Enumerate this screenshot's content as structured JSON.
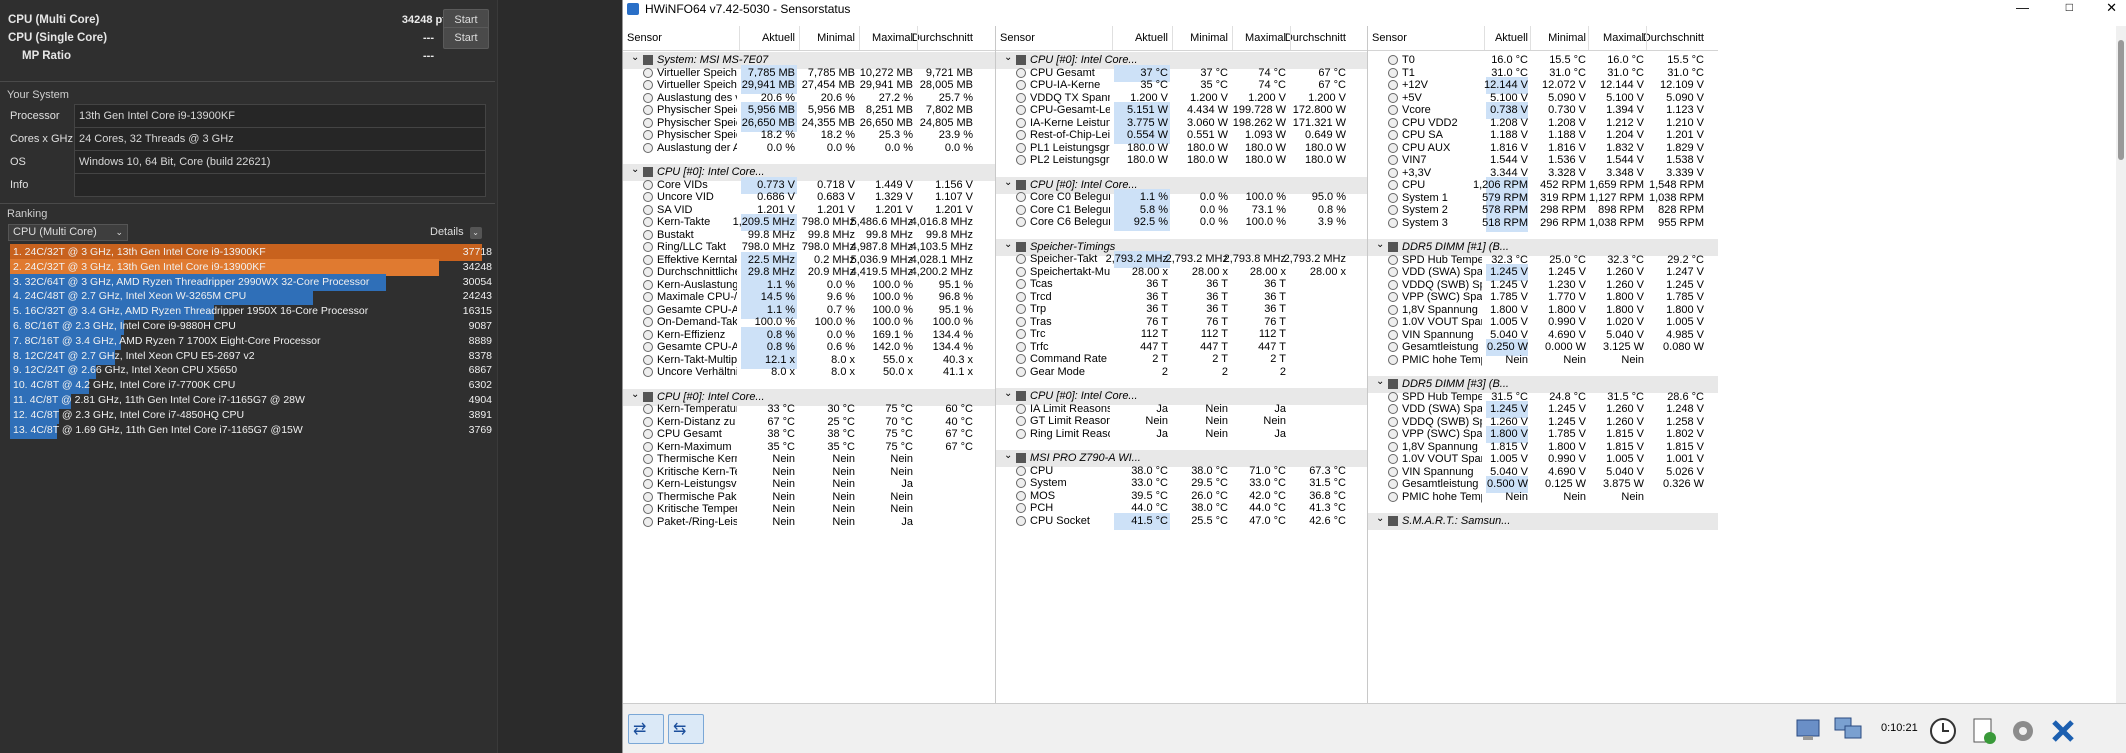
{
  "cb": {
    "mc_label": "CPU (Multi Core)",
    "mc_val": "34248 pts",
    "st_label": "CPU (Single Core)",
    "st_val": "---",
    "mp_label": "MP Ratio",
    "mp_val": "---",
    "start": "Start",
    "your_system": "Your System",
    "processor_k": "Processor",
    "processor_v": "13th Gen Intel Core i9-13900KF",
    "cores_k": "Cores x GHz",
    "cores_v": "24 Cores, 32 Threads @ 3 GHz",
    "os_k": "OS",
    "os_v": "Windows 10, 64 Bit, Core (build 22621)",
    "info_k": "Info",
    "info_v": "",
    "ranking": "Ranking",
    "rank_select": "CPU (Multi Core)",
    "details": "Details",
    "ranks": [
      {
        "t": "1. 24C/32T @ 3 GHz, 13th Gen Intel Core i9-13900KF",
        "s": "37718",
        "c": "#c8621e",
        "f": 1.0
      },
      {
        "t": "2. 24C/32T @ 3 GHz, 13th Gen Intel Core i9-13900KF",
        "s": "34248",
        "c": "#e07a30",
        "f": 0.908
      },
      {
        "t": "3. 32C/64T @ 3 GHz, AMD Ryzen Threadripper 2990WX 32-Core Processor",
        "s": "30054",
        "c": "#2f6fb8",
        "f": 0.797
      },
      {
        "t": "4. 24C/48T @ 2.7 GHz, Intel Xeon W-3265M CPU",
        "s": "24243",
        "c": "#2f6fb8",
        "f": 0.643
      },
      {
        "t": "5. 16C/32T @ 3.4 GHz, AMD Ryzen Threadripper 1950X 16-Core Processor",
        "s": "16315",
        "c": "#2f6fb8",
        "f": 0.433
      },
      {
        "t": "6. 8C/16T @ 2.3 GHz, Intel Core i9-9880H CPU",
        "s": "9087",
        "c": "#2f6fb8",
        "f": 0.241
      },
      {
        "t": "7. 8C/16T @ 3.4 GHz, AMD Ryzen 7 1700X Eight-Core Processor",
        "s": "8889",
        "c": "#2f6fb8",
        "f": 0.236
      },
      {
        "t": "8. 12C/24T @ 2.7 GHz, Intel Xeon CPU E5-2697 v2",
        "s": "8378",
        "c": "#2f6fb8",
        "f": 0.222
      },
      {
        "t": "9. 12C/24T @ 2.66 GHz, Intel Xeon CPU X5650",
        "s": "6867",
        "c": "#2f6fb8",
        "f": 0.182
      },
      {
        "t": "10. 4C/8T @ 4.2 GHz, Intel Core i7-7700K CPU",
        "s": "6302",
        "c": "#2f6fb8",
        "f": 0.167
      },
      {
        "t": "11. 4C/8T @ 2.81 GHz, 11th Gen Intel Core i7-1165G7 @ 28W",
        "s": "4904",
        "c": "#2f6fb8",
        "f": 0.13
      },
      {
        "t": "12. 4C/8T @ 2.3 GHz, Intel Core i7-4850HQ CPU",
        "s": "3891",
        "c": "#2f6fb8",
        "f": 0.103
      },
      {
        "t": "13. 4C/8T @ 1.69 GHz, 11th Gen Intel Core i7-1165G7 @15W",
        "s": "3769",
        "c": "#2f6fb8",
        "f": 0.1
      }
    ]
  },
  "hw": {
    "title": "HWiNFO64 v7.42-5030 - Sensorstatus",
    "clock": "0:10:21",
    "cols": [
      "Sensor",
      "Aktuell",
      "Minimal",
      "Maximal",
      "Durchschnitt"
    ],
    "p1": [
      [
        "g",
        "System: MSI MS-7E07"
      ],
      [
        "r",
        "Virtueller Speicher zu...",
        "7,785 MB",
        "7,785 MB",
        "10,272 MB",
        "9,721 MB",
        1
      ],
      [
        "r",
        "Virtueller Speicher ve...",
        "29,941 MB",
        "27,454 MB",
        "29,941 MB",
        "28,005 MB",
        1
      ],
      [
        "r",
        "Auslastung des virtu...",
        "20.6 %",
        "20.6 %",
        "27.2 %",
        "25.7 %",
        0
      ],
      [
        "r",
        "Physischer Speicher ...",
        "5,956 MB",
        "5,956 MB",
        "8,251 MB",
        "7,802 MB",
        1
      ],
      [
        "r",
        "Physischer Speicher ...",
        "26,650 MB",
        "24,355 MB",
        "26,650 MB",
        "24,805 MB",
        1
      ],
      [
        "r",
        "Physischer Speicher-...",
        "18.2 %",
        "18.2 %",
        "25.3 %",
        "23.9 %",
        0
      ],
      [
        "r",
        "Auslastung der Ausla...",
        "0.0 %",
        "0.0 %",
        "0.0 %",
        "0.0 %",
        0
      ],
      [
        "s"
      ],
      [
        "g",
        "CPU [#0]: Intel Core..."
      ],
      [
        "r",
        "Core VIDs",
        "0.773 V",
        "0.718 V",
        "1.449 V",
        "1.156 V",
        1
      ],
      [
        "r",
        "Uncore VID",
        "0.686 V",
        "0.683 V",
        "1.329 V",
        "1.107 V",
        0
      ],
      [
        "r",
        "SA VID",
        "1.201 V",
        "1.201 V",
        "1.201 V",
        "1.201 V",
        0
      ],
      [
        "r",
        "Kern-Takte",
        "1,209.5 MHz",
        "798.0 MHz",
        "5,486.6 MHz",
        "4,016.8 MHz",
        1
      ],
      [
        "r",
        "Bustakt",
        "99.8 MHz",
        "99.8 MHz",
        "99.8 MHz",
        "99.8 MHz",
        0
      ],
      [
        "r",
        "Ring/LLC Takt",
        "798.0 MHz",
        "798.0 MHz",
        "4,987.8 MHz",
        "4,103.5 MHz",
        0
      ],
      [
        "r",
        "Effektive Kerntakte",
        "22.5 MHz",
        "0.2 MHz",
        "5,036.9 MHz",
        "4,028.1 MHz",
        1
      ],
      [
        "r",
        "Durchschnittlicher Ef...",
        "29.8 MHz",
        "20.9 MHz",
        "4,419.5 MHz",
        "4,200.2 MHz",
        1
      ],
      [
        "r",
        "Kern-Auslastung",
        "1.1 %",
        "0.0 %",
        "100.0 %",
        "95.1 %",
        1
      ],
      [
        "r",
        "Maximale CPU-/Thre...",
        "14.5 %",
        "9.6 %",
        "100.0 %",
        "96.8 %",
        1
      ],
      [
        "r",
        "Gesamte CPU-Auslas...",
        "1.1 %",
        "0.7 %",
        "100.0 %",
        "95.1 %",
        1
      ],
      [
        "r",
        "On-Demand-Takt-Mo...",
        "100.0 %",
        "100.0 %",
        "100.0 %",
        "100.0 %",
        0
      ],
      [
        "r",
        "Kern-Effizienz",
        "0.8 %",
        "0.0 %",
        "169.1 %",
        "134.4 %",
        1
      ],
      [
        "r",
        "Gesamte CPU-Auslas...",
        "0.8 %",
        "0.6 %",
        "142.0 %",
        "134.4 %",
        1
      ],
      [
        "r",
        "Kern-Takt-Multipli...",
        "12.1 x",
        "8.0 x",
        "55.0 x",
        "40.3 x",
        1
      ],
      [
        "r",
        "Uncore Verhältnis",
        "8.0 x",
        "8.0 x",
        "50.0 x",
        "41.1 x",
        0
      ],
      [
        "s"
      ],
      [
        "g",
        "CPU [#0]: Intel Core..."
      ],
      [
        "r",
        "Kern-Temperaturen",
        "33 °C",
        "30 °C",
        "75 °C",
        "60 °C",
        0
      ],
      [
        "r",
        "Kern-Distanz zu T...",
        "67 °C",
        "25 °C",
        "70 °C",
        "40 °C",
        0
      ],
      [
        "r",
        "CPU Gesamt",
        "38 °C",
        "38 °C",
        "75 °C",
        "67 °C",
        0
      ],
      [
        "r",
        "Kern-Maximum",
        "35 °C",
        "35 °C",
        "75 °C",
        "67 °C",
        0
      ],
      [
        "r",
        "Thermische Kern-...",
        "Nein",
        "Nein",
        "Nein",
        "",
        0
      ],
      [
        "r",
        "Kritische Kern-Te...",
        "Nein",
        "Nein",
        "Nein",
        "",
        0
      ],
      [
        "r",
        "Kern-Leistungsve...",
        "Nein",
        "Nein",
        "Ja",
        "",
        0
      ],
      [
        "r",
        "Thermische Paket-/Ri...",
        "Nein",
        "Nein",
        "Nein",
        "",
        0
      ],
      [
        "r",
        "Kritische Temperatur...",
        "Nein",
        "Nein",
        "Nein",
        "",
        0
      ],
      [
        "r",
        "Paket-/Ring-Leistung...",
        "Nein",
        "Nein",
        "Ja",
        "",
        0
      ]
    ],
    "p2": [
      [
        "g",
        "CPU [#0]: Intel Core..."
      ],
      [
        "r",
        "CPU Gesamt",
        "37 °C",
        "37 °C",
        "74 °C",
        "67 °C",
        1
      ],
      [
        "r",
        "CPU-IA-Kerne",
        "35 °C",
        "35 °C",
        "74 °C",
        "67 °C",
        0
      ],
      [
        "r",
        "VDDQ TX Spannung",
        "1.200 V",
        "1.200 V",
        "1.200 V",
        "1.200 V",
        0
      ],
      [
        "r",
        "CPU-Gesamt-Leistun...",
        "5.151 W",
        "4.434 W",
        "199.728 W",
        "172.800 W",
        1
      ],
      [
        "r",
        "IA-Kerne Leistungsa...",
        "3.775 W",
        "3.060 W",
        "198.262 W",
        "171.321 W",
        1
      ],
      [
        "r",
        "Rest-of-Chip-Leistun...",
        "0.554 W",
        "0.551 W",
        "1.093 W",
        "0.649 W",
        1
      ],
      [
        "r",
        "PL1 Leistungsgrenze",
        "180.0 W",
        "180.0 W",
        "180.0 W",
        "180.0 W",
        0
      ],
      [
        "r",
        "PL2 Leistungsgrenze",
        "180.0 W",
        "180.0 W",
        "180.0 W",
        "180.0 W",
        0
      ],
      [
        "s"
      ],
      [
        "g",
        "CPU [#0]: Intel Core..."
      ],
      [
        "r",
        "Core C0 Belegung",
        "1.1 %",
        "0.0 %",
        "100.0 %",
        "95.0 %",
        1
      ],
      [
        "r",
        "Core C1 Belegung",
        "5.8 %",
        "0.0 %",
        "73.1 %",
        "0.8 %",
        1
      ],
      [
        "r",
        "Core C6 Belegung",
        "92.5 %",
        "0.0 %",
        "100.0 %",
        "3.9 %",
        1
      ],
      [
        "s"
      ],
      [
        "g",
        "Speicher-Timings"
      ],
      [
        "r",
        "Speicher-Takt",
        "2,793.2 MHz",
        "2,793.2 MHz",
        "2,793.8 MHz",
        "2,793.2 MHz",
        1
      ],
      [
        "r",
        "Speichertakt-Multiplik...",
        "28.00 x",
        "28.00 x",
        "28.00 x",
        "28.00 x",
        0
      ],
      [
        "r",
        "Tcas",
        "36 T",
        "36 T",
        "36 T",
        "",
        0
      ],
      [
        "r",
        "Trcd",
        "36 T",
        "36 T",
        "36 T",
        "",
        0
      ],
      [
        "r",
        "Trp",
        "36 T",
        "36 T",
        "36 T",
        "",
        0
      ],
      [
        "r",
        "Tras",
        "76 T",
        "76 T",
        "76 T",
        "",
        0
      ],
      [
        "r",
        "Trc",
        "112 T",
        "112 T",
        "112 T",
        "",
        0
      ],
      [
        "r",
        "Trfc",
        "447 T",
        "447 T",
        "447 T",
        "",
        0
      ],
      [
        "r",
        "Command Rate",
        "2 T",
        "2 T",
        "2 T",
        "",
        0
      ],
      [
        "r",
        "Gear Mode",
        "2",
        "2",
        "2",
        "",
        0
      ],
      [
        "s"
      ],
      [
        "g",
        "CPU [#0]: Intel Core..."
      ],
      [
        "r",
        "IA Limit Reasons",
        "Ja",
        "Nein",
        "Ja",
        "",
        0
      ],
      [
        "r",
        "GT Limit Reasons",
        "Nein",
        "Nein",
        "Nein",
        "",
        0
      ],
      [
        "r",
        "Ring Limit Reasons",
        "Ja",
        "Nein",
        "Ja",
        "",
        0
      ],
      [
        "s"
      ],
      [
        "g",
        "MSI PRO Z790-A WI..."
      ],
      [
        "r",
        "CPU",
        "38.0 °C",
        "38.0 °C",
        "71.0 °C",
        "67.3 °C",
        0
      ],
      [
        "r",
        "System",
        "33.0 °C",
        "29.5 °C",
        "33.0 °C",
        "31.5 °C",
        0
      ],
      [
        "r",
        "MOS",
        "39.5 °C",
        "26.0 °C",
        "42.0 °C",
        "36.8 °C",
        0
      ],
      [
        "r",
        "PCH",
        "44.0 °C",
        "38.0 °C",
        "44.0 °C",
        "41.3 °C",
        0
      ],
      [
        "r",
        "CPU Socket",
        "41.5 °C",
        "25.5 °C",
        "47.0 °C",
        "42.6 °C",
        1
      ]
    ],
    "p3": [
      [
        "r",
        "T0",
        "16.0 °C",
        "15.5 °C",
        "16.0 °C",
        "15.5 °C",
        0
      ],
      [
        "r",
        "T1",
        "31.0 °C",
        "31.0 °C",
        "31.0 °C",
        "31.0 °C",
        0
      ],
      [
        "r",
        "+12V",
        "12.144 V",
        "12.072 V",
        "12.144 V",
        "12.109 V",
        1
      ],
      [
        "r",
        "+5V",
        "5.100 V",
        "5.090 V",
        "5.100 V",
        "5.090 V",
        0
      ],
      [
        "r",
        "Vcore",
        "0.738 V",
        "0.730 V",
        "1.394 V",
        "1.123 V",
        1
      ],
      [
        "r",
        "CPU VDD2",
        "1.208 V",
        "1.208 V",
        "1.212 V",
        "1.210 V",
        0
      ],
      [
        "r",
        "CPU SA",
        "1.188 V",
        "1.188 V",
        "1.204 V",
        "1.201 V",
        0
      ],
      [
        "r",
        "CPU AUX",
        "1.816 V",
        "1.816 V",
        "1.832 V",
        "1.829 V",
        0
      ],
      [
        "r",
        "VIN7",
        "1.544 V",
        "1.536 V",
        "1.544 V",
        "1.538 V",
        0
      ],
      [
        "r",
        "+3,3V",
        "3.344 V",
        "3.328 V",
        "3.348 V",
        "3.339 V",
        0
      ],
      [
        "r",
        "CPU",
        "1,206 RPM",
        "452 RPM",
        "1,659 RPM",
        "1,548 RPM",
        1
      ],
      [
        "r",
        "System 1",
        "579 RPM",
        "319 RPM",
        "1,127 RPM",
        "1,038 RPM",
        1
      ],
      [
        "r",
        "System 2",
        "578 RPM",
        "298 RPM",
        "898 RPM",
        "828 RPM",
        1
      ],
      [
        "r",
        "System 3",
        "518 RPM",
        "296 RPM",
        "1,038 RPM",
        "955 RPM",
        1
      ],
      [
        "s"
      ],
      [
        "g",
        "DDR5 DIMM [#1] (B..."
      ],
      [
        "r",
        "SPD Hub Temperatur",
        "32.3 °C",
        "25.0 °C",
        "32.3 °C",
        "29.2 °C",
        0
      ],
      [
        "r",
        "VDD (SWA) Spannung",
        "1.245 V",
        "1.245 V",
        "1.260 V",
        "1.247 V",
        1
      ],
      [
        "r",
        "VDDQ (SWB) Spannung",
        "1.245 V",
        "1.230 V",
        "1.260 V",
        "1.245 V",
        0
      ],
      [
        "r",
        "VPP (SWC) Spannung",
        "1.785 V",
        "1.770 V",
        "1.800 V",
        "1.785 V",
        0
      ],
      [
        "r",
        "1,8V Spannung",
        "1.800 V",
        "1.800 V",
        "1.800 V",
        "1.800 V",
        0
      ],
      [
        "r",
        "1.0V VOUT Spannung",
        "1.005 V",
        "0.990 V",
        "1.020 V",
        "1.005 V",
        0
      ],
      [
        "r",
        "VIN Spannung",
        "5.040 V",
        "4.690 V",
        "5.040 V",
        "4.985 V",
        0
      ],
      [
        "r",
        "Gesamtleistung",
        "0.250 W",
        "0.000 W",
        "3.125 W",
        "0.080 W",
        1
      ],
      [
        "r",
        "PMIC hohe Temperatur",
        "Nein",
        "Nein",
        "Nein",
        "",
        0
      ],
      [
        "s"
      ],
      [
        "g",
        "DDR5 DIMM [#3] (B..."
      ],
      [
        "r",
        "SPD Hub Temperatur",
        "31.5 °C",
        "24.8 °C",
        "31.5 °C",
        "28.6 °C",
        0
      ],
      [
        "r",
        "VDD (SWA) Spannung",
        "1.245 V",
        "1.245 V",
        "1.260 V",
        "1.248 V",
        1
      ],
      [
        "r",
        "VDDQ (SWB) Spannung",
        "1.260 V",
        "1.245 V",
        "1.260 V",
        "1.258 V",
        0
      ],
      [
        "r",
        "VPP (SWC) Spannung",
        "1.800 V",
        "1.785 V",
        "1.815 V",
        "1.802 V",
        1
      ],
      [
        "r",
        "1,8V Spannung",
        "1.815 V",
        "1.800 V",
        "1.815 V",
        "1.815 V",
        0
      ],
      [
        "r",
        "1.0V VOUT Spannung",
        "1.005 V",
        "0.990 V",
        "1.005 V",
        "1.001 V",
        0
      ],
      [
        "r",
        "VIN Spannung",
        "5.040 V",
        "4.690 V",
        "5.040 V",
        "5.026 V",
        0
      ],
      [
        "r",
        "Gesamtleistung",
        "0.500 W",
        "0.125 W",
        "3.875 W",
        "0.326 W",
        1
      ],
      [
        "r",
        "PMIC hohe Temperatur",
        "Nein",
        "Nein",
        "Nein",
        "",
        0
      ],
      [
        "s"
      ],
      [
        "g",
        "S.M.A.R.T.: Samsun..."
      ]
    ]
  }
}
